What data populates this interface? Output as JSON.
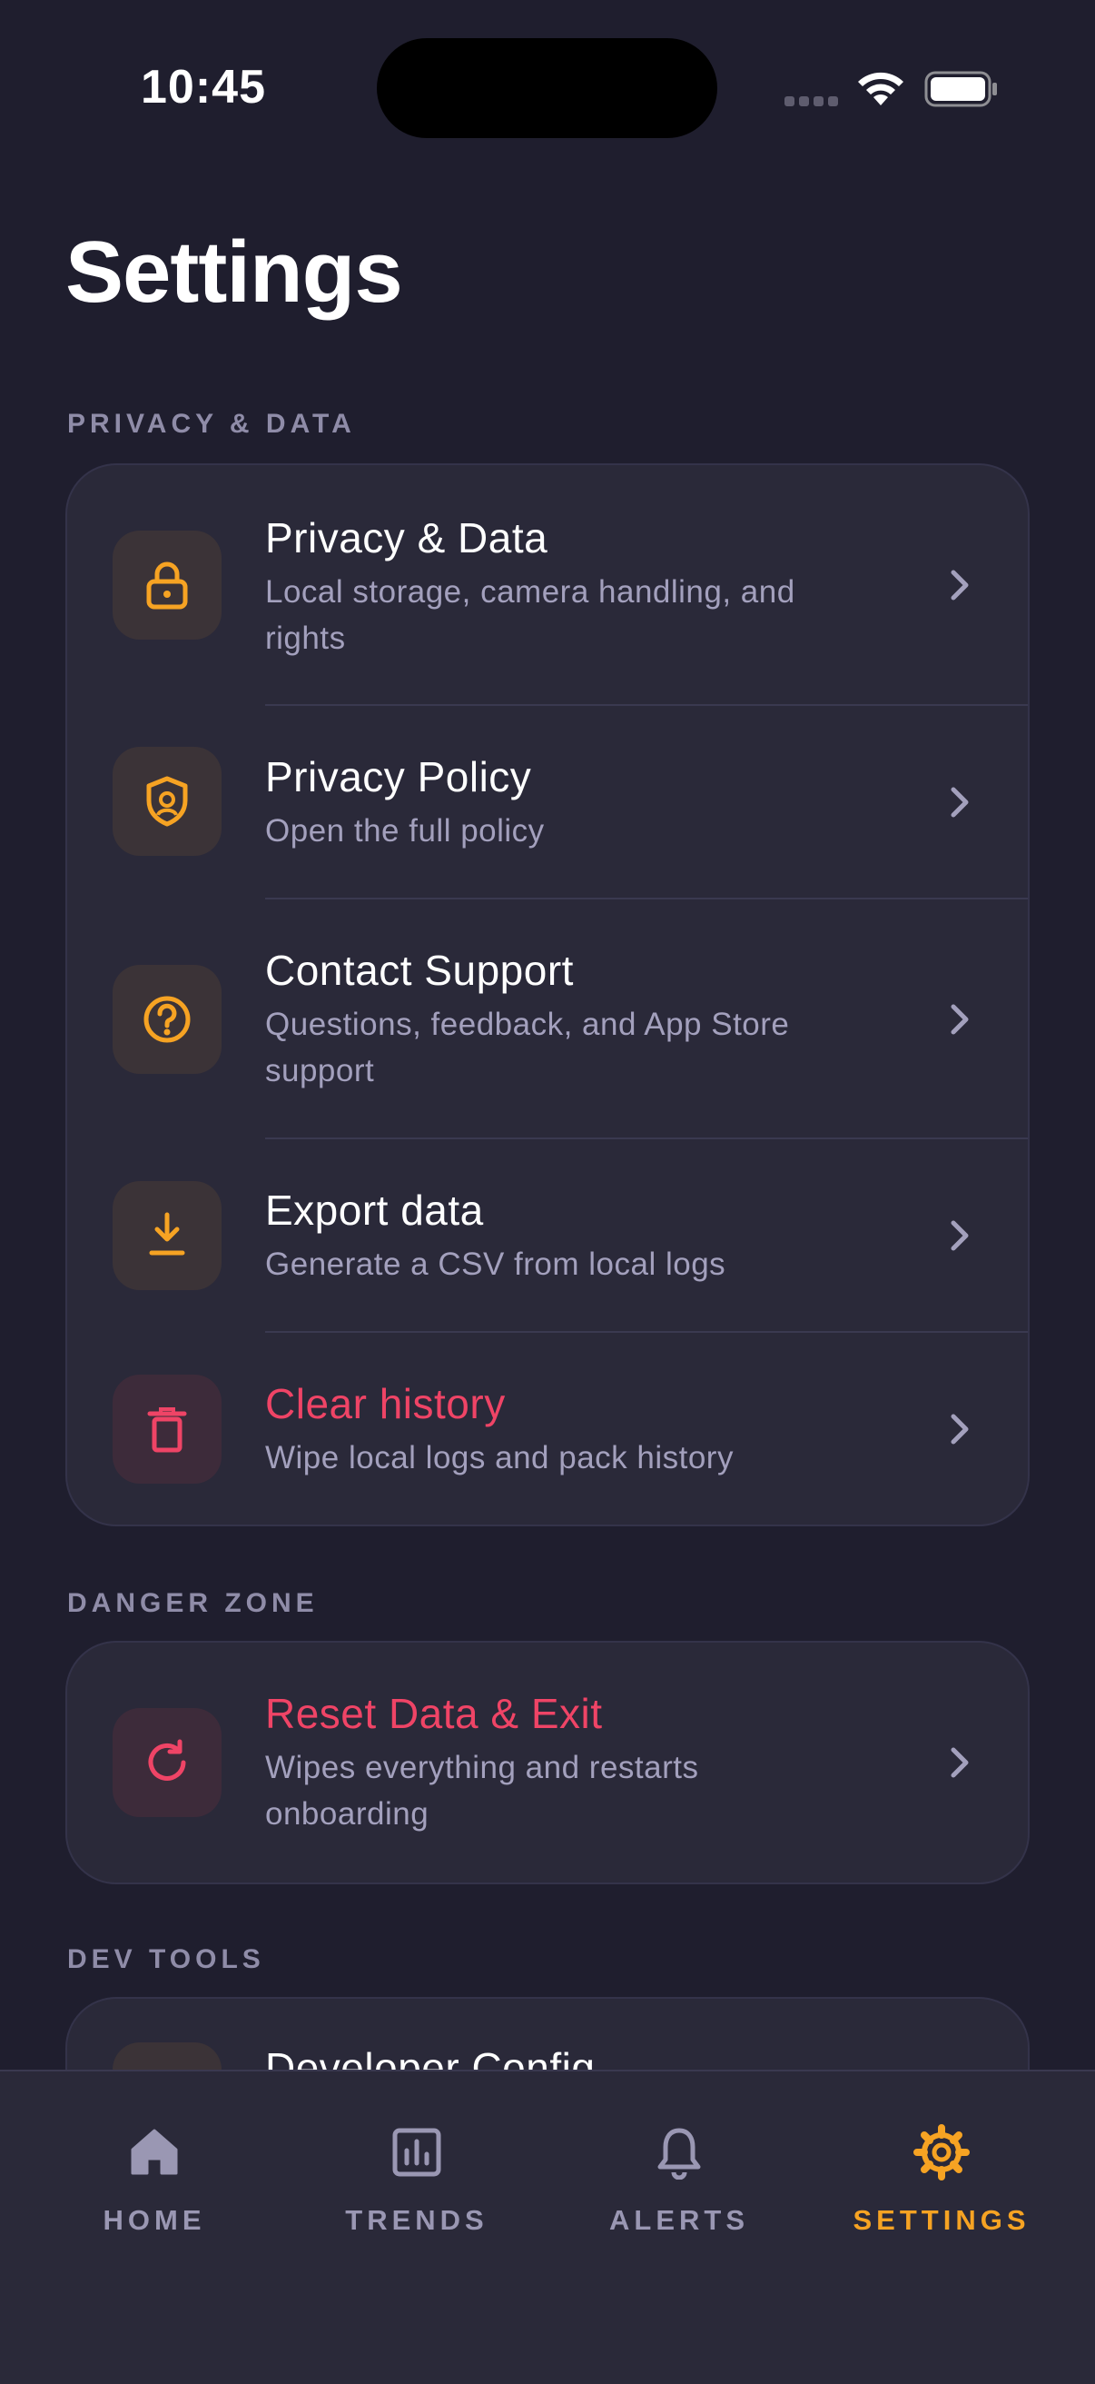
{
  "status_bar": {
    "time": "10:45"
  },
  "page": {
    "title": "Settings"
  },
  "sections": {
    "privacy": {
      "label": "PRIVACY & DATA",
      "items": [
        {
          "title": "Privacy & Data",
          "subtitle_line1": "Local storage, camera handling, and",
          "subtitle_line2": "rights",
          "icon": "lock-icon"
        },
        {
          "title": "Privacy Policy",
          "subtitle_line1": "Open the full policy",
          "icon": "shield-icon"
        },
        {
          "title": "Contact Support",
          "subtitle_line1": "Questions, feedback, and App Store",
          "subtitle_line2": "support",
          "icon": "question-circle-icon"
        },
        {
          "title": "Export data",
          "subtitle_line1": "Generate a CSV from local logs",
          "icon": "download-icon"
        },
        {
          "title": "Clear history",
          "subtitle_line1": "Wipe local logs and pack history",
          "icon": "trash-icon"
        }
      ]
    },
    "danger": {
      "label": "DANGER ZONE",
      "items": [
        {
          "title": "Reset Data & Exit",
          "subtitle_line1": "Wipes everything and restarts",
          "subtitle_line2": "onboarding",
          "icon": "refresh-icon"
        }
      ]
    },
    "dev": {
      "label": "DEV TOOLS",
      "items": [
        {
          "title": "Developer Config"
        }
      ]
    }
  },
  "tab_bar": {
    "tabs": [
      {
        "label": "HOME",
        "icon": "home-icon"
      },
      {
        "label": "TRENDS",
        "icon": "chart-icon"
      },
      {
        "label": "ALERTS",
        "icon": "bell-icon"
      },
      {
        "label": "SETTINGS",
        "icon": "gear-icon",
        "active": true
      }
    ]
  },
  "colors": {
    "accent": "#f6a323",
    "danger": "#ef4466",
    "background": "#1f1e2e",
    "card": "#2a2939"
  }
}
